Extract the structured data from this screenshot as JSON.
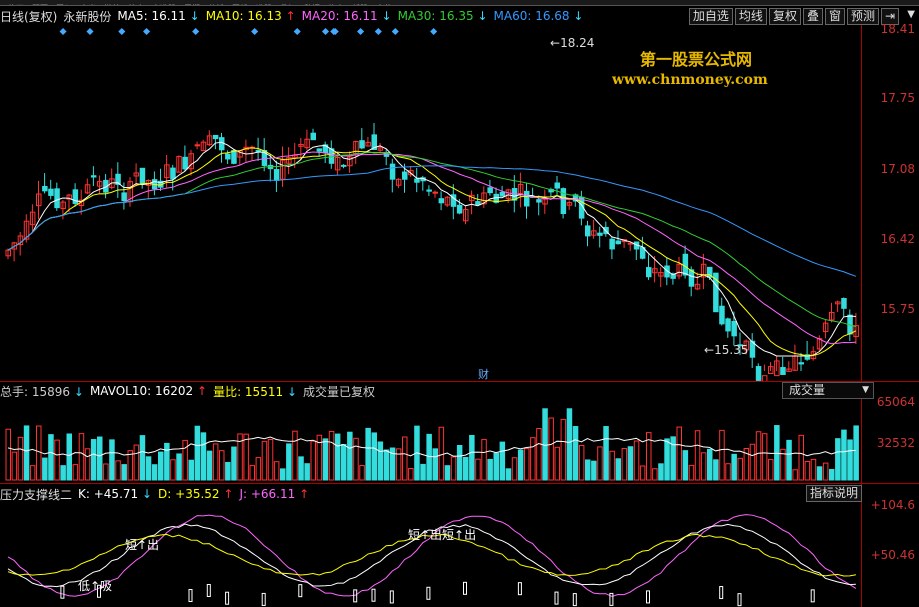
{
  "top_menu": [
    "修正",
    "照面",
    "买入",
    "卖出",
    "撤单",
    "外广",
    "自选股",
    "周期",
    "分析",
    "画线",
    "选股",
    "叠加",
    "数据",
    "热点",
    "新股",
    "定位"
  ],
  "price_panel": {
    "title": "日线(复权)",
    "stock_name": "永新股份",
    "ma5_label": "MA5: 16.11",
    "ma10_label": "MA10: 16.13",
    "ma20_label": "MA20: 16.11",
    "ma30_label": "MA30: 16.35",
    "ma60_label": "MA60: 16.68",
    "arrow_down": "↓",
    "arrow_up": "↑",
    "toolbar": [
      "加自选",
      "均线",
      "复权",
      "叠",
      "窗",
      "预测"
    ],
    "nav_icon": "last-page-icon",
    "menu_icon": "chevron-down-icon",
    "y_ticks": [
      "18.41",
      "17.75",
      "17.08",
      "16.42",
      "15.75"
    ],
    "high_label": "18.24",
    "low_label": "15.35",
    "cai_marker": "财",
    "watermark_title": "第一股票公式网",
    "watermark_url": "www.chnmoney.com"
  },
  "volume_panel": {
    "total_label": "总手: 15896",
    "mavol_label": "MAVOL10: 16202",
    "ratio_label": "量比: 15511",
    "note": "成交量已复权",
    "dropdown_value": "成交量",
    "y_ticks": [
      "65064",
      "32532"
    ]
  },
  "indicator_panel": {
    "name": "压力支撑线二",
    "k_label": "K: +45.71",
    "d_label": "D: +35.52",
    "j_label": "J: +66.11",
    "help_button": "指标说明",
    "y_ticks": [
      "+104.6",
      "+50.46"
    ],
    "annotations": [
      "短↑出",
      "短↑出短↑出",
      "低↑吸"
    ]
  },
  "colors": {
    "up": "#ff3333",
    "down": "#33dddd",
    "ma5": "#ffffff",
    "ma10": "#ffff00",
    "ma20": "#ff66ff",
    "ma30": "#33cc33",
    "ma60": "#3399ff",
    "axis": "#aa0000",
    "watermark": "#e6b800"
  }
}
